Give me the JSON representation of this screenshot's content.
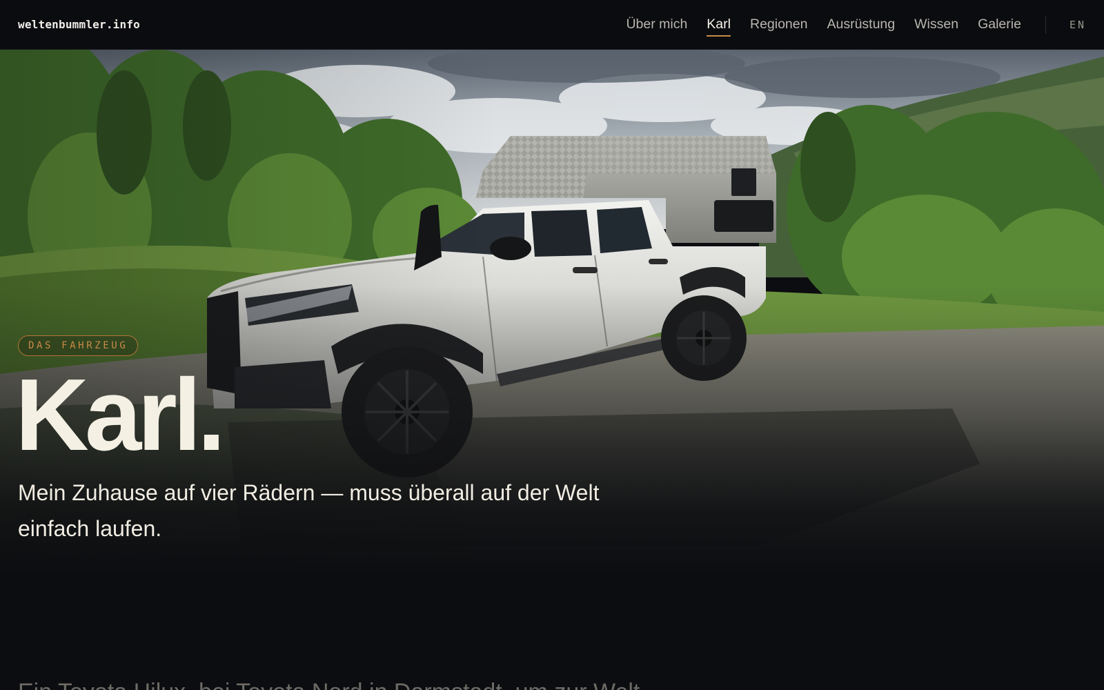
{
  "header": {
    "logo": "weltenbummler.info",
    "nav": [
      {
        "label": "Über mich",
        "active": false
      },
      {
        "label": "Karl",
        "active": true
      },
      {
        "label": "Regionen",
        "active": false
      },
      {
        "label": "Ausrüstung",
        "active": false
      },
      {
        "label": "Wissen",
        "active": false
      },
      {
        "label": "Galerie",
        "active": false
      }
    ],
    "language": "EN"
  },
  "hero": {
    "badge": "DAS FAHRZEUG",
    "title": "Karl.",
    "subtitle": "Mein Zuhause auf vier Rädern — muss überall auf der Welt einfach laufen.",
    "image_alt": "Weißer Toyota Hilux mit Aluminium-Wohnkabine auf einem Schotterplatz vor grünem Wald"
  },
  "intro": {
    "text_partial": "Ein Toyota Hilux, bei Toyota Nord in Darmstadt, um zur Welt ..."
  },
  "colors": {
    "background": "#0c0d10",
    "accent": "#c98a4a",
    "text": "#f4f0e4",
    "nav_text": "#b9b6ae"
  }
}
